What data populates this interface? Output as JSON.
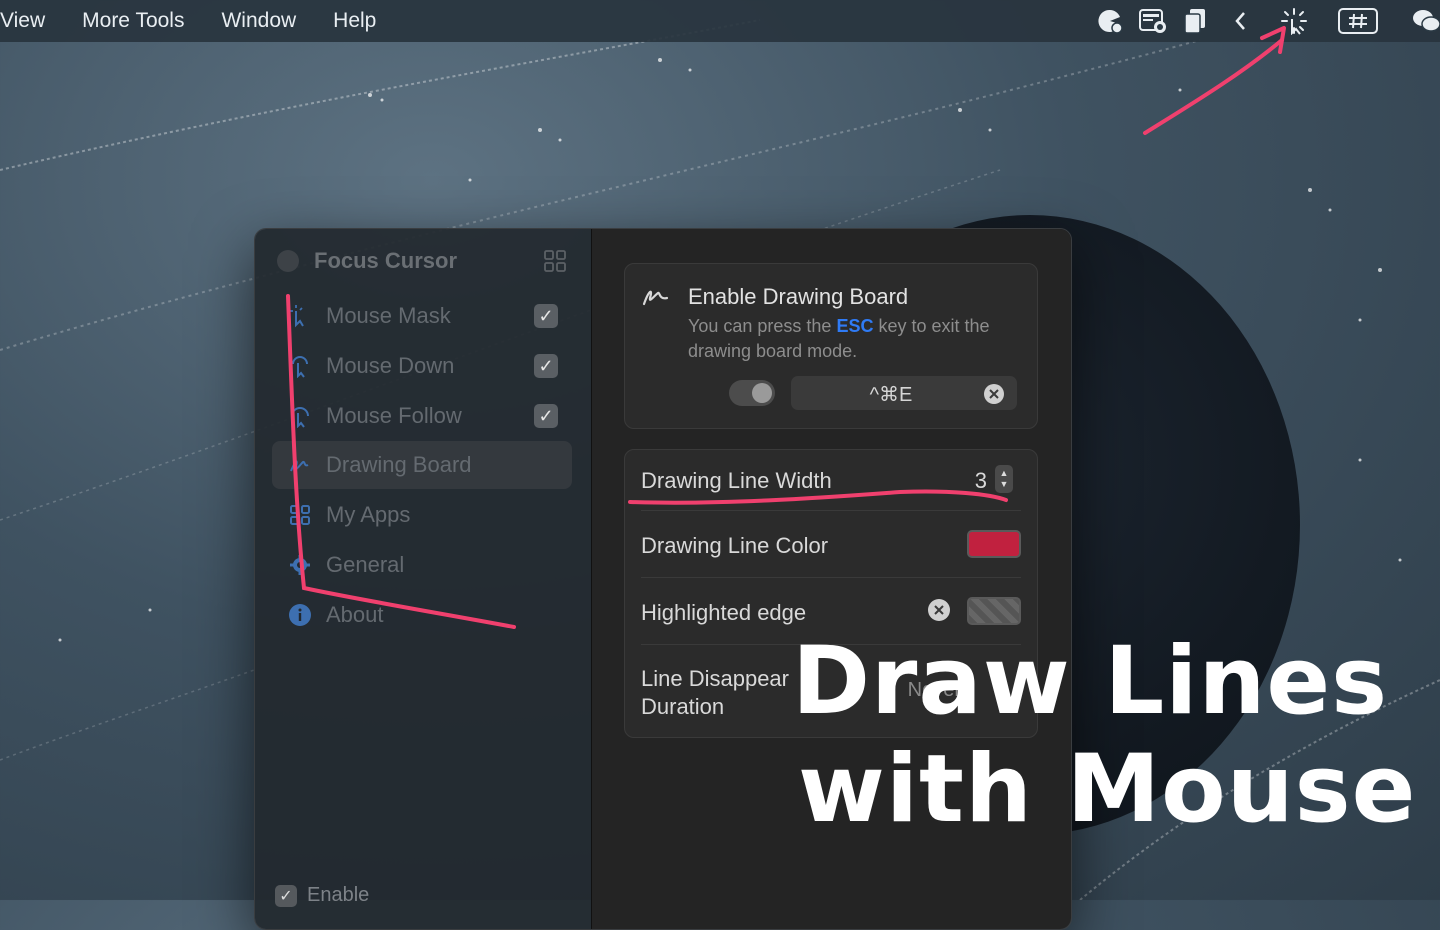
{
  "menubar": {
    "items": [
      "View",
      "More Tools",
      "Window",
      "Help"
    ],
    "icons": [
      "pacman-icon",
      "calendar-icon",
      "documents-icon",
      "chevron-left-icon",
      "focus-cursor-icon",
      "hash-icon",
      "wechat-icon"
    ]
  },
  "sidebar": {
    "app_title": "Focus Cursor",
    "items": [
      {
        "label": "Mouse Mask",
        "icon": "mouse-mask-icon",
        "checked": true
      },
      {
        "label": "Mouse Down",
        "icon": "mouse-down-icon",
        "checked": true
      },
      {
        "label": "Mouse Follow",
        "icon": "mouse-follow-icon",
        "checked": true
      },
      {
        "label": "Drawing Board",
        "icon": "drawing-board-icon",
        "active": true
      },
      {
        "label": "My Apps",
        "icon": "my-apps-icon"
      },
      {
        "label": "General",
        "icon": "gear-icon"
      },
      {
        "label": "About",
        "icon": "info-icon"
      }
    ],
    "enable_label": "Enable"
  },
  "settings": {
    "enable_title": "Enable Drawing Board",
    "desc_before": "You can press the ",
    "desc_key": "ESC",
    "desc_after": " key to exit the drawing board mode.",
    "toggle_on": false,
    "shortcut": "^⌘E",
    "line_width_label": "Drawing Line Width",
    "line_width_value": "3",
    "line_color_label": "Drawing Line Color",
    "line_color": "#c1213f",
    "edge_label": "Highlighted edge",
    "duration_label": "Line Disappear Duration",
    "duration_value": "Never"
  },
  "promo": {
    "line1": "Draw Lines",
    "line2": "with Mouse"
  },
  "colors": {
    "annotation": "#f0406e",
    "accent": "#2f7bf5"
  }
}
